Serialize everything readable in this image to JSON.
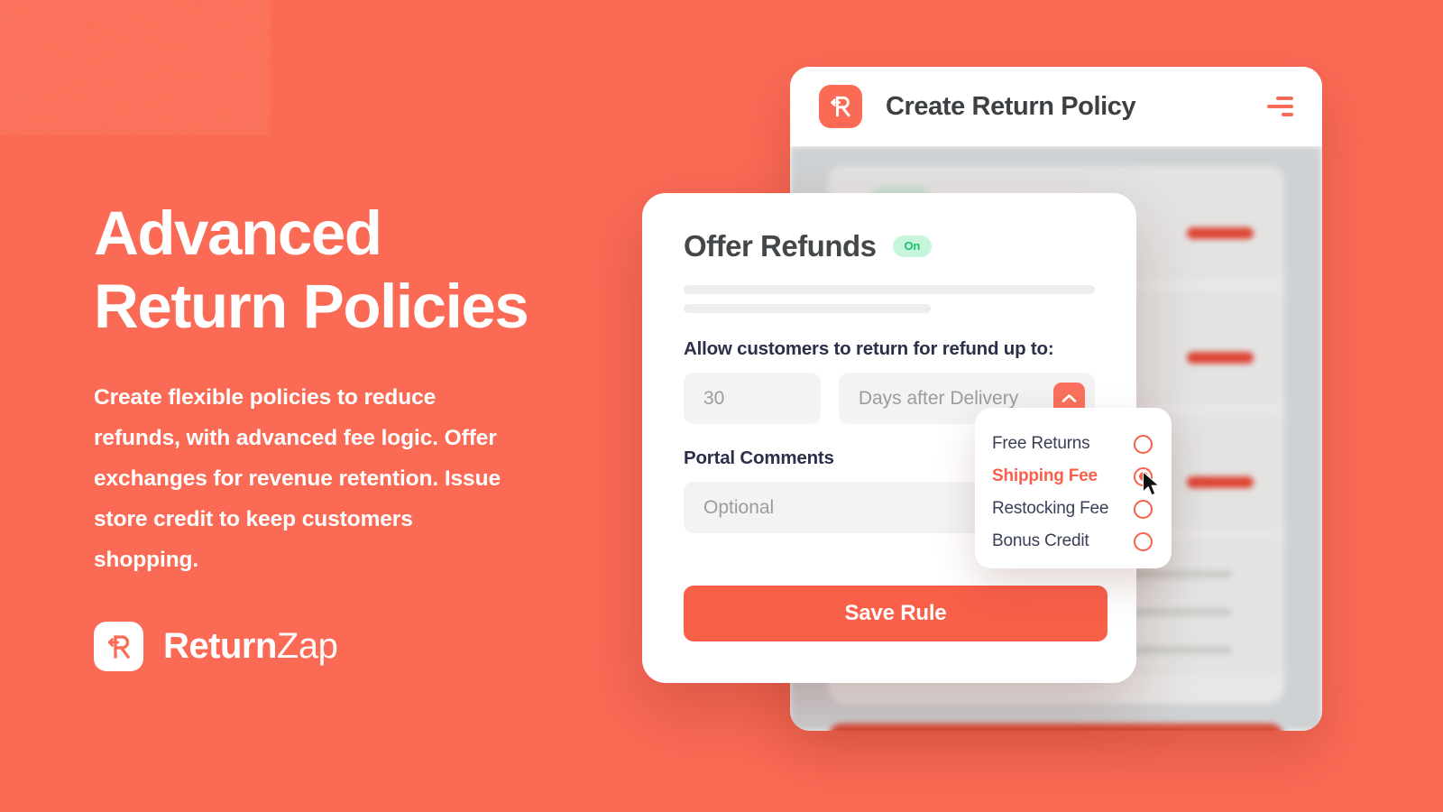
{
  "brand": {
    "accent": "#FA6A55",
    "button_color": "#F9604A",
    "background_color": "#FA6A55",
    "name_bold": "Return",
    "name_light": "Zap",
    "logo_icon": "returnzap-r-arrow-icon"
  },
  "marketing": {
    "headline_line1": "Advanced",
    "headline_line2": "Return Policies",
    "subcopy": "Create flexible policies to reduce refunds, with advanced fee logic. Offer exchanges for revenue retention. Issue store credit to keep customers shopping."
  },
  "app": {
    "header": {
      "title": "Create Return Policy",
      "logo_icon": "returnzap-r-arrow-icon",
      "menu_icon": "hamburger-menu-icon"
    }
  },
  "modal": {
    "title": "Offer Refunds",
    "status_badge": "On",
    "status_badge_color": "#19c26a",
    "field_label": "Allow customers to return for refund up to:",
    "days_value": "30",
    "period_value": "Days after Delivery",
    "period_toggle_icon": "chevron-up-icon",
    "comments_label": "Portal Comments",
    "comments_placeholder": "Optional",
    "save_label": "Save Rule"
  },
  "dropdown": {
    "options": [
      {
        "label": "Free Returns",
        "selected": false
      },
      {
        "label": "Shipping Fee",
        "selected": true
      },
      {
        "label": "Restocking Fee",
        "selected": false
      },
      {
        "label": "Bonus Credit",
        "selected": false
      }
    ]
  }
}
